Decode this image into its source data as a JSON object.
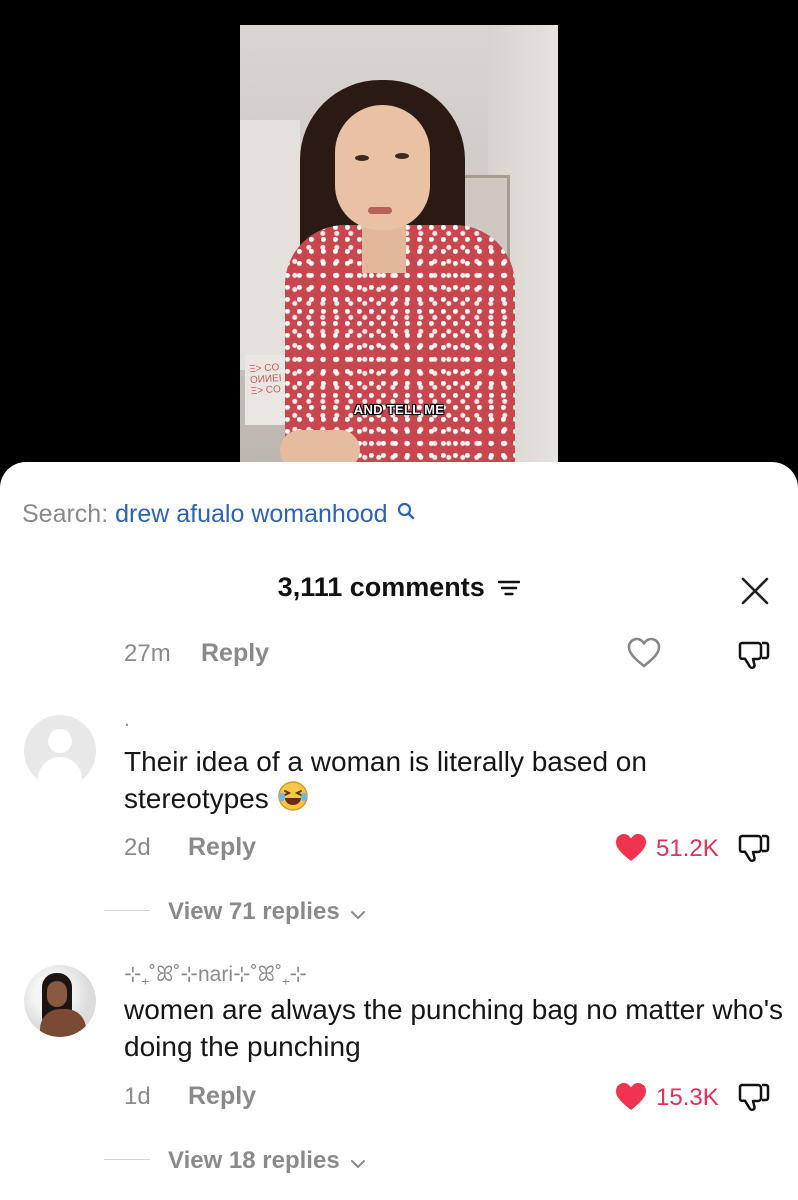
{
  "video": {
    "caption": "AND TELL ME"
  },
  "search": {
    "label": "Search:",
    "term": "drew afualo womanhood"
  },
  "header": {
    "comments_count": "3,111 comments"
  },
  "top_reply_row": {
    "time": "27m",
    "reply": "Reply"
  },
  "comments": [
    {
      "username": ".",
      "text": "Their idea of a woman is literally based on stereotypes",
      "time": "2d",
      "reply": "Reply",
      "likes": "51.2K",
      "view_replies": "View 71 replies"
    },
    {
      "username": "⊹₊˚ꕤ˚⊹nari⊹˚ꕤ˚₊⊹",
      "text": "women are always the punching bag no matter who's doing the punching",
      "time": "1d",
      "reply": "Reply",
      "likes": "15.3K",
      "view_replies": "View 18 replies"
    }
  ],
  "colors": {
    "search_term": "#2b63b7",
    "liked_heart": "#f0344f",
    "like_count": "#e1305a",
    "muted_text": "#8a8a8a"
  },
  "icons": [
    "search-icon",
    "sort-icon",
    "close-icon",
    "heart-icon",
    "dislike-icon",
    "chevron-down-icon",
    "laughing-emoji"
  ]
}
